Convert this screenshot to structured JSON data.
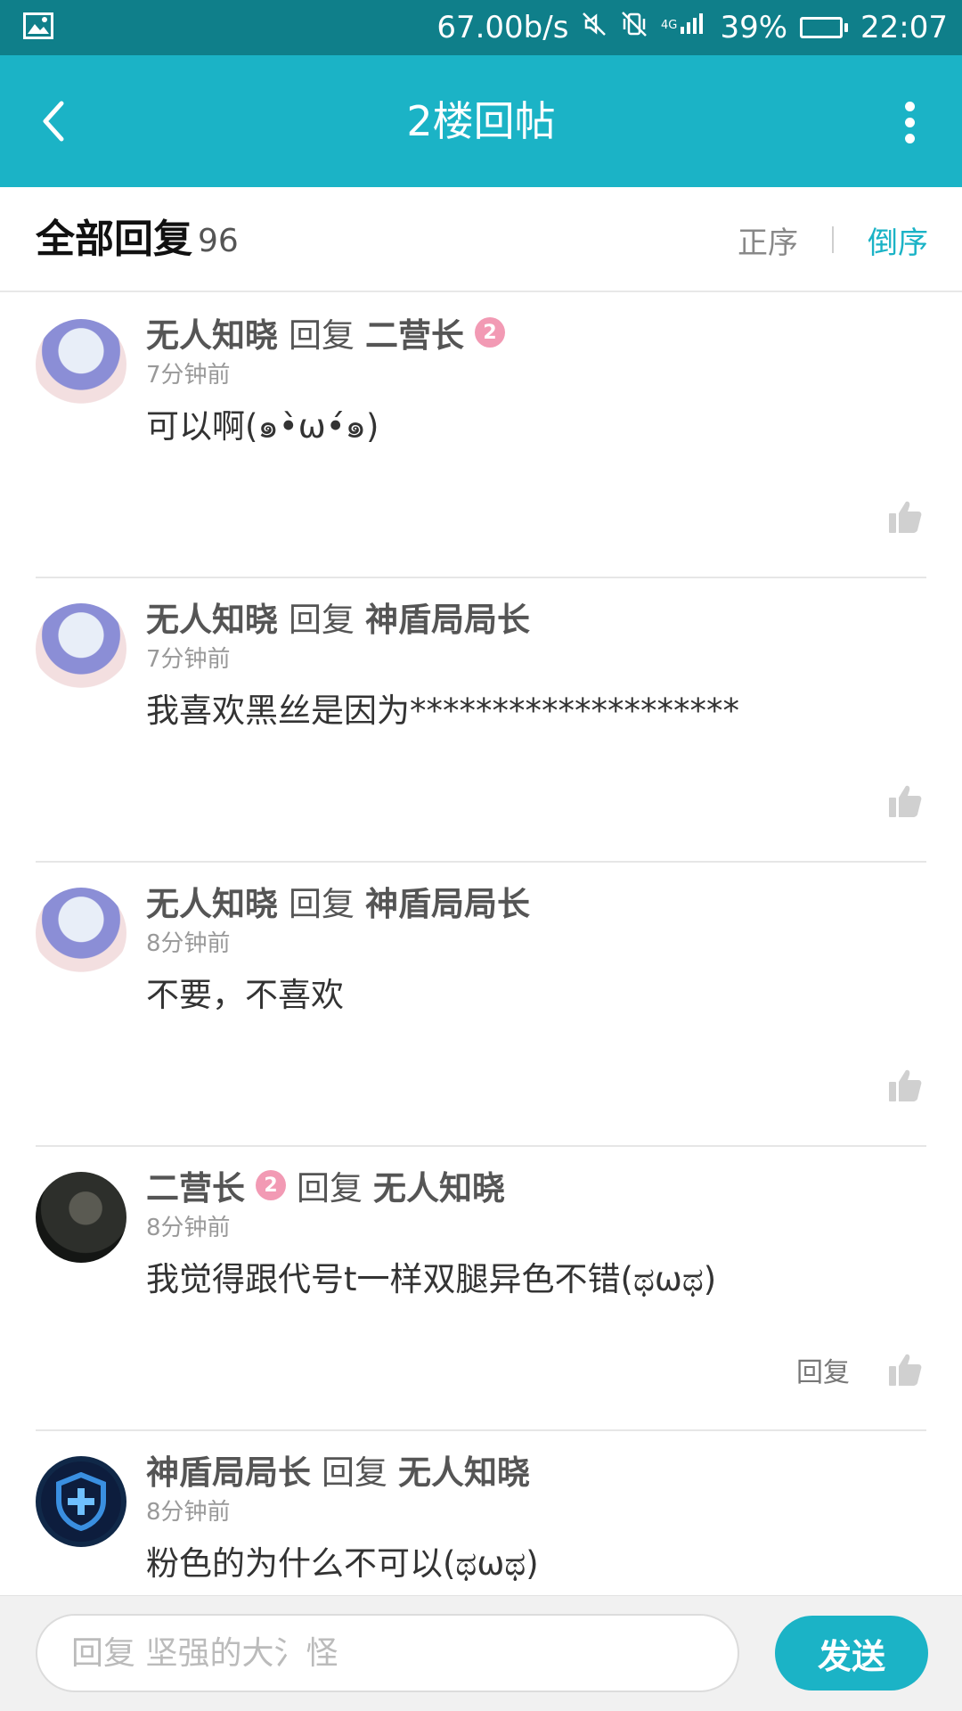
{
  "status_bar": {
    "left_icon": "image-icon",
    "network_speed": "67.00b/s",
    "icons": [
      "mute-icon",
      "vibrate-off-icon",
      "signal-4g-icon"
    ],
    "battery_text": "39%",
    "battery_level": 0.39,
    "time": "22:07"
  },
  "header": {
    "title": "2楼回帖",
    "back_icon": "chevron-left-icon",
    "menu_icon": "more-vertical-icon"
  },
  "sort_bar": {
    "title": "全部回复",
    "count": "96",
    "asc_label": "正序",
    "desc_label": "倒序",
    "active": "倒序"
  },
  "replies": [
    {
      "author": "无人知晓",
      "reply_word": "回复",
      "target": "二营长",
      "target_level": "2",
      "time": "7分钟前",
      "content": "可以啊(๑•̀ω•́๑)",
      "avatar": "anime-girl",
      "reply_label": "",
      "like_icon": "thumbs-up-icon"
    },
    {
      "author": "无人知晓",
      "reply_word": "回复",
      "target": "神盾局局长",
      "time": "7分钟前",
      "content": "我喜欢黑丝是因为********************",
      "avatar": "anime-girl",
      "reply_label": "",
      "like_icon": "thumbs-up-icon"
    },
    {
      "author": "无人知晓",
      "reply_word": "回复",
      "target": "神盾局局长",
      "time": "8分钟前",
      "content": "不要，不喜欢",
      "avatar": "anime-girl",
      "reply_label": "",
      "like_icon": "thumbs-up-icon"
    },
    {
      "author": "二营长",
      "author_level": "2",
      "reply_word": "回复",
      "target": "无人知晓",
      "time": "8分钟前",
      "content": "我觉得跟代号t一样双腿异色不错(ಥωಥ)",
      "avatar": "soldier",
      "reply_label": "回复",
      "like_icon": "thumbs-up-icon"
    },
    {
      "author": "神盾局局长",
      "reply_word": "回复",
      "target": "无人知晓",
      "time": "8分钟前",
      "content": "粉色的为什么不可以(ಥωಥ)",
      "avatar": "shield",
      "reply_label": "",
      "like_icon": "thumbs-up-icon"
    }
  ],
  "input_bar": {
    "placeholder": "回复 坚强的大氵怪",
    "send_label": "发送"
  },
  "colors": {
    "status_bar": "#0f7f8a",
    "accent": "#1bb3c6",
    "badge_pink": "#f29ab4"
  }
}
